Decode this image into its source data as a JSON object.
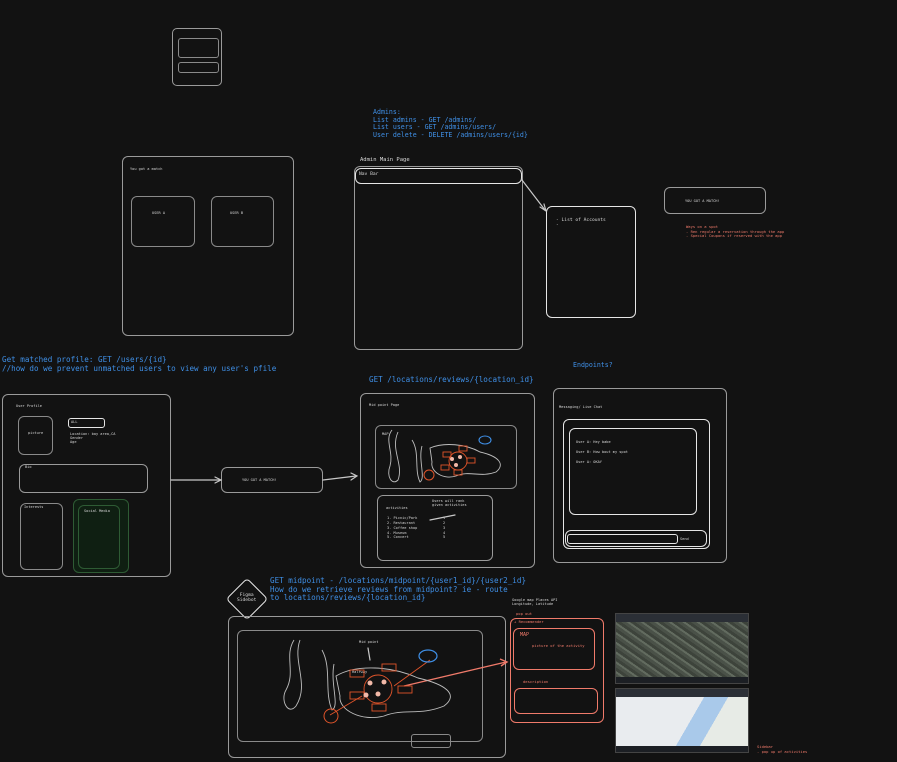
{
  "admin_notes": {
    "heading": "Admins:",
    "lines": [
      "List admins - GET /admins/",
      "List users - GET /admins/users/",
      "User delete - DELETE /admins/users/{id}"
    ]
  },
  "admin_page": {
    "title": "Admin Main Page",
    "nav_bar": "Nav Bar",
    "accounts_list": [
      "- List of Accounts",
      "-"
    ]
  },
  "match_frame": {
    "caption": "You got a match",
    "user_a": "USER A",
    "user_b": "USER B"
  },
  "match_popup_top": "YOU GOT A MATCH!",
  "match_popup_mid": "YOU GOT A MATCH!",
  "match_note": {
    "lines": [
      "Ways on a spot",
      "- Ren regular a reservation through the app",
      "- Special Coupons if reserved with the app"
    ]
  },
  "profile_note": {
    "lines": [
      "Get matched profile: GET /users/{id}",
      "//how do we prevent unmatched users to view any user's pfile"
    ]
  },
  "user_profile": {
    "title": "User Profile",
    "picture": "picture",
    "name_field": "ALL",
    "info_lines": [
      "Location: bay area,CA",
      "Gender",
      "Age"
    ],
    "bio": "Bio",
    "interests": "Interests",
    "social_media": "Social Media"
  },
  "reviews_note": "GET /locations/reviews/{location_id}",
  "midpoint_page": {
    "title": "Mid point Page",
    "map_label": "MAP",
    "activities_label": "activities",
    "note": [
      "Users will rank",
      "given activities"
    ],
    "ranked": [
      "1. Picnic/Park",
      "2. Restaurant",
      "3. Coffee shop",
      "4. Museum",
      "5. Concert"
    ],
    "scores": [
      "1",
      "2",
      "3",
      "4",
      "5"
    ]
  },
  "endpoints_label": "Endpoints?",
  "chat": {
    "title": "Messaging/ Live Chat",
    "messages": [
      "User A: Hey babe",
      "User B: How bout my spot",
      "User A: OKAY"
    ],
    "send": "Send"
  },
  "figma": {
    "label": [
      "Figma",
      "Sidebot"
    ]
  },
  "midpoint_note": {
    "lines": [
      "GET midpoint - /locations/midpoint/{user1_id}/{user2_id}",
      "How do we retrieve reviews from midpoint? ie - route",
      "to locations/reviews/{location_id}"
    ]
  },
  "midpoint_sketch": {
    "title": "Mid point",
    "sub": "Halfway"
  },
  "google_maps_note": [
    "Google map Places API",
    "Longitude, Latitude"
  ],
  "popup": {
    "label": "pop out",
    "header": "+ Recommender",
    "map_label": "MAP",
    "map_sub": "picture of the activity",
    "description": "description"
  },
  "sidebar_note": [
    "Sidebar",
    "- pop up of activities"
  ],
  "colors": {
    "background": "#121212",
    "stroke": "#9a9a9a",
    "blue_text": "#3f8fe6",
    "red_accent": "#f07a6a",
    "orange_marker": "#c8541c"
  }
}
